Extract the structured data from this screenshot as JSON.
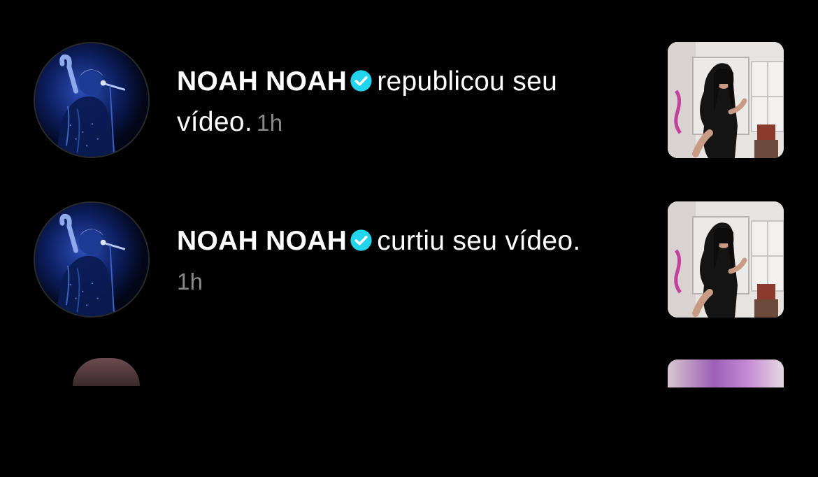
{
  "notifications": [
    {
      "username": "NOAH NOAH",
      "verified": true,
      "action_text": "republicou seu vídeo.",
      "time": "1h",
      "avatar_icon": "profile-photo-performer-with-microphone",
      "thumbnail_icon": "video-thumbnail-dancer"
    },
    {
      "username": "NOAH NOAH",
      "verified": true,
      "action_text": "curtiu seu vídeo.",
      "time": "1h",
      "avatar_icon": "profile-photo-performer-with-microphone",
      "thumbnail_icon": "video-thumbnail-dancer"
    }
  ],
  "colors": {
    "background": "#000000",
    "primary_text": "#ffffff",
    "secondary_text": "#8a8a8a",
    "verified_badge": "#20d5ec"
  }
}
